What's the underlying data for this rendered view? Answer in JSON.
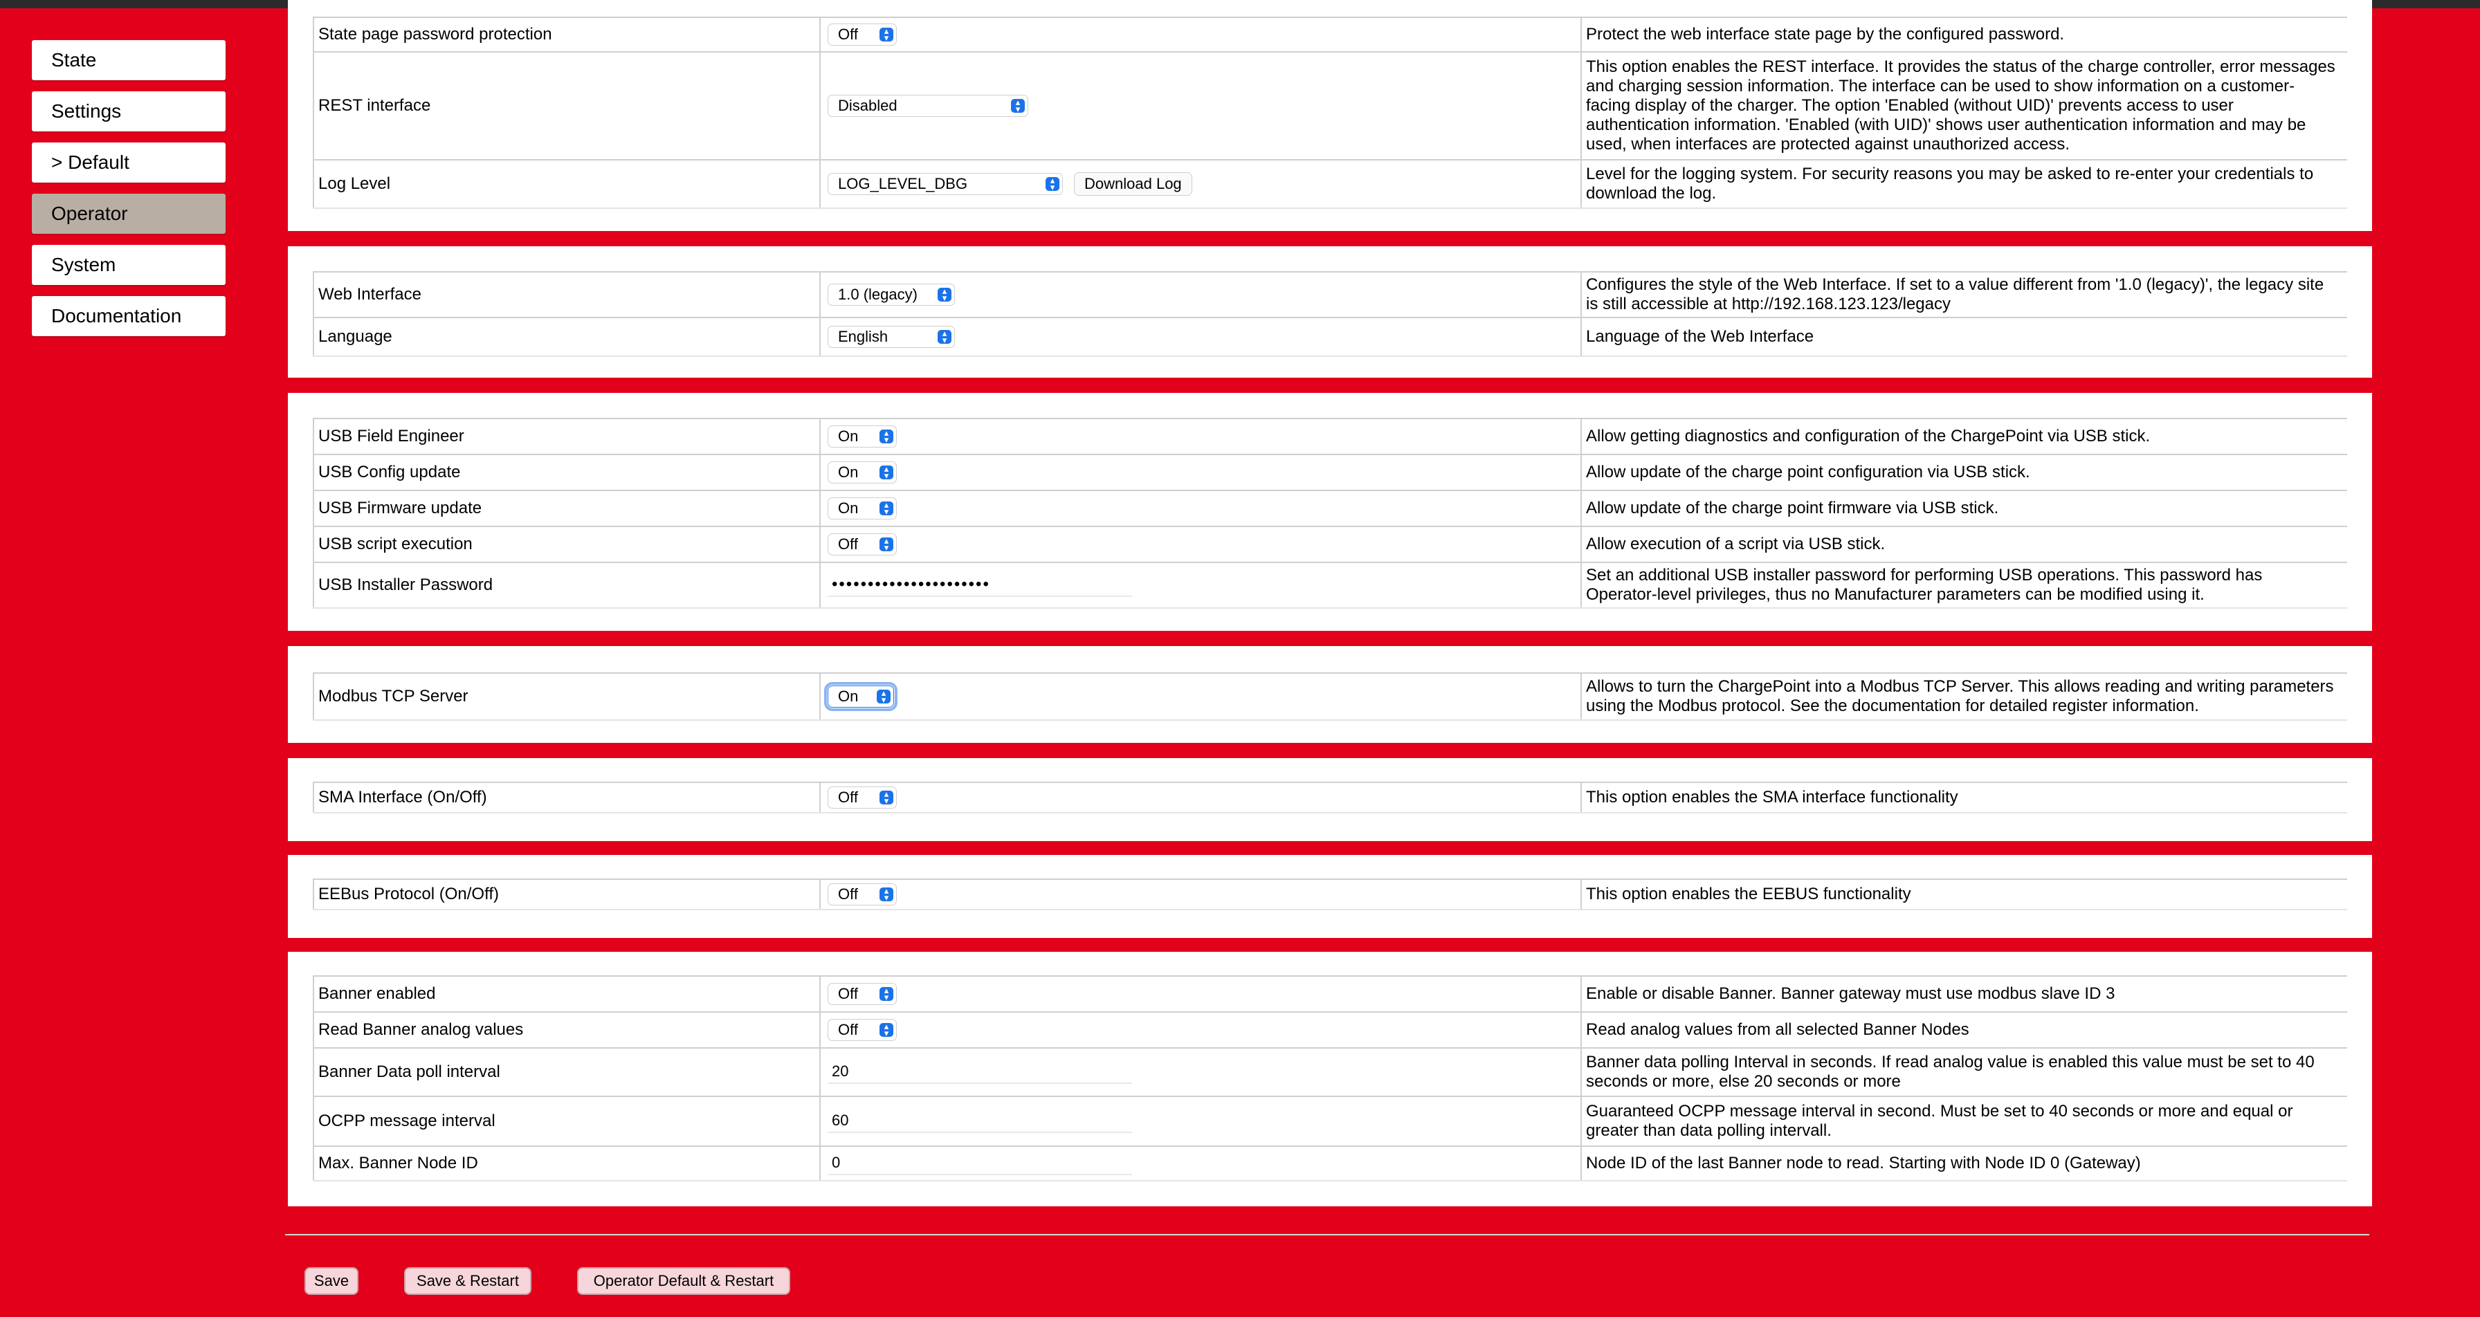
{
  "nav": [
    "State",
    "Settings",
    "> Default",
    "Operator",
    "System",
    "Documentation"
  ],
  "rest_panel": {
    "state_pw_label": "State page password protection",
    "state_pw_value": "Off",
    "state_pw_desc": "Protect the web interface state page by the configured password.",
    "rest_label": "REST interface",
    "rest_value": "Disabled",
    "rest_desc": "This option enables the REST interface. It provides the status of the charge controller, error messages and charging session information. The interface can be used to show information on a customer-facing display of the charger. The option 'Enabled (without UID)' prevents access to user authentication information. 'Enabled (with UID)' shows user authentication information and may be used, when interfaces are protected against unauthorized access.",
    "log_label": "Log Level",
    "log_value": "LOG_LEVEL_DBG",
    "log_button": "Download Log",
    "log_desc": "Level for the logging system. For security reasons you may be asked to re-enter your credentials to download the log."
  },
  "web_panel": {
    "web_label": "Web Interface",
    "web_value": "1.0 (legacy)",
    "web_desc": "Configures the style of the Web Interface. If set to a value different from '1.0 (legacy)', the legacy site is still accessible at http://192.168.123.123/legacy",
    "lang_label": "Language",
    "lang_value": "English",
    "lang_desc": "Language of the Web Interface"
  },
  "usb_panel": {
    "field_label": "USB Field Engineer",
    "field_value": "On",
    "field_desc": "Allow getting diagnostics and configuration of the ChargePoint via USB stick.",
    "config_label": "USB Config update",
    "config_value": "On",
    "config_desc": "Allow update of the charge point configuration via USB stick.",
    "firmware_label": "USB Firmware update",
    "firmware_value": "On",
    "firmware_desc": "Allow update of the charge point firmware via USB stick.",
    "script_label": "USB script execution",
    "script_value": "Off",
    "script_desc": "Allow execution of a script via USB stick.",
    "pw_label": "USB Installer Password",
    "pw_value": "••••••••••••••••••••••",
    "pw_desc": "Set an additional USB installer password for performing USB operations. This password has Operator-level privileges, thus no Manufacturer parameters can be modified using it."
  },
  "modbus_panel": {
    "label": "Modbus TCP Server",
    "value": "On",
    "desc": "Allows to turn the ChargePoint into a Modbus TCP Server. This allows reading and writing parameters using the Modbus protocol. See the documentation for detailed register information."
  },
  "sma_panel": {
    "label": "SMA Interface (On/Off)",
    "value": "Off",
    "desc": "This option enables the SMA interface functionality"
  },
  "eebus_panel": {
    "label": "EEBus Protocol (On/Off)",
    "value": "Off",
    "desc": "This option enables the EEBUS functionality"
  },
  "banner_panel": {
    "enabled_label": "Banner enabled",
    "enabled_value": "Off",
    "enabled_desc": "Enable or disable Banner. Banner gateway must use modbus slave ID 3",
    "analog_label": "Read Banner analog values",
    "analog_value": "Off",
    "analog_desc": "Read analog values from all selected Banner Nodes",
    "poll_label": "Banner Data poll interval",
    "poll_value": "20",
    "poll_desc": "Banner data polling Interval in seconds. If read analog value is enabled this value must be set to 40 seconds or more, else 20 seconds or more",
    "ocpp_label": "OCPP message interval",
    "ocpp_value": "60",
    "ocpp_desc": "Guaranteed OCPP message interval in second. Must be set to 40 seconds or more and equal or greater than data polling intervall.",
    "node_label": "Max. Banner Node ID",
    "node_value": "0",
    "node_desc": "Node ID of the last Banner node to read. Starting with Node ID 0 (Gateway)"
  },
  "footer": {
    "save": "Save",
    "save_restart": "Save & Restart",
    "default_restart": "Operator Default & Restart"
  }
}
